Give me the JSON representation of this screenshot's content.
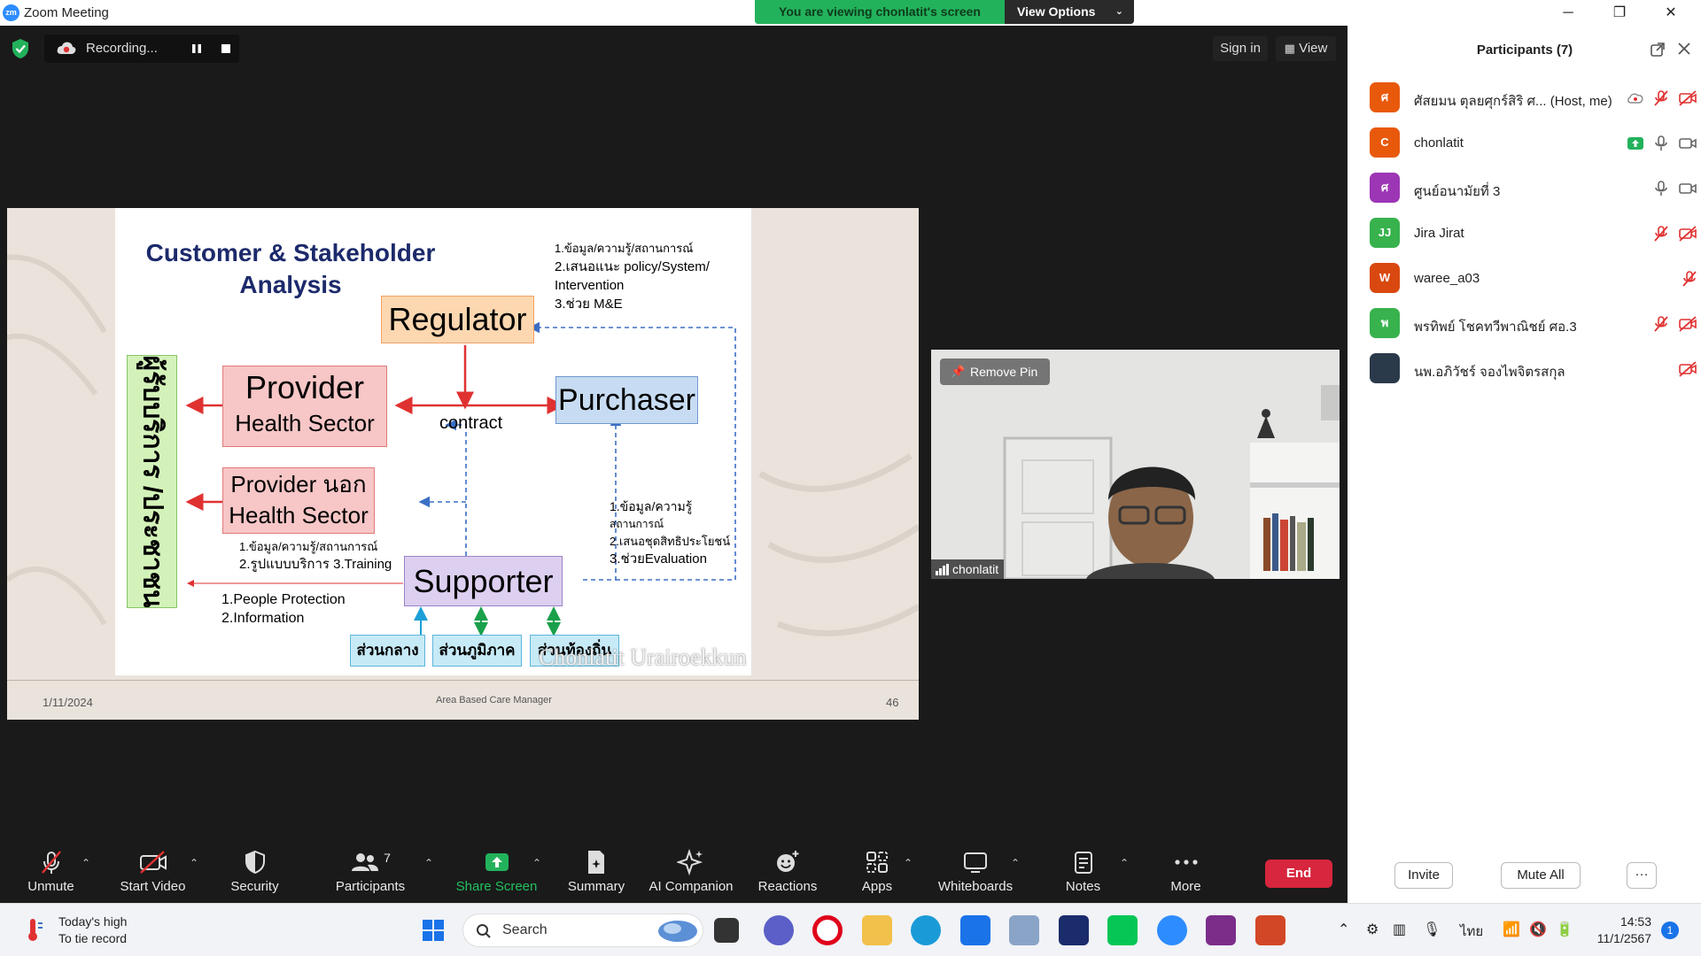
{
  "window": {
    "title": "Zoom Meeting",
    "min": "─",
    "max": "❐",
    "close": "✕"
  },
  "banner": {
    "viewing": "You are viewing chonlatit's screen",
    "view_options": "View Options"
  },
  "recording": {
    "label": "Recording..."
  },
  "header": {
    "sign_in": "Sign in",
    "view": "View"
  },
  "slide": {
    "title_line1": "Customer & Stakeholder",
    "title_line2": "Analysis",
    "regulator": "Regulator",
    "provider": "Provider",
    "provider_sub": "Health Sector",
    "purchaser": "Purchaser",
    "contract": "contract",
    "provider2": "Provider นอก",
    "provider2_sub": "Health Sector",
    "supporter": "Supporter",
    "vertical_label": "ผู้รับบริการ /ประชาชน",
    "reg_note1": "1.ข้อมูล/ความรู้/สถานการณ์",
    "reg_note2": "2.เสนอแนะ policy/System/",
    "reg_note3": "Intervention",
    "reg_note4": "3.ช่วย M&E",
    "pur_note1": "1.ข้อมูล/ความรู้",
    "pur_note2": "สถานการณ์",
    "pur_note3": "2.เสนอชุดสิทธิประโยชน์",
    "pur_note4": "3.ช่วยEvaluation",
    "prov_note1": "1.ข้อมูล/ความรู้/สถานการณ์",
    "prov_note2": "2.รูปแบบบริการ 3.Training",
    "people1": "1.People Protection",
    "people2": "2.Information",
    "central": "ส่วนกลาง",
    "regional": "ส่วนภูมิภาค",
    "local": "ส่วนท้องถิ่น",
    "watermark": "Chonlatit Urairoekkun",
    "footer_date": "1/11/2024",
    "footer_center": "Area Based Care Manager",
    "footer_page": "46"
  },
  "video": {
    "remove_pin": "Remove Pin",
    "name": "chonlatit"
  },
  "toolbar": {
    "unmute": "Unmute",
    "start_video": "Start Video",
    "security": "Security",
    "participants": "Participants",
    "participants_count": "7",
    "share_screen": "Share Screen",
    "summary": "Summary",
    "ai_companion": "AI Companion",
    "reactions": "Reactions",
    "apps": "Apps",
    "whiteboards": "Whiteboards",
    "notes": "Notes",
    "more": "More",
    "end": "End"
  },
  "panel": {
    "title": "Participants (7)",
    "invite": "Invite",
    "mute_all": "Mute All",
    "more": "···",
    "participants": [
      {
        "initial": "ศ",
        "name": "ศัสยมน ตุลยศุกร์สิริ ศ...  (Host, me)",
        "color": "#e8590c"
      },
      {
        "initial": "C",
        "name": "chonlatit",
        "color": "#e8590c"
      },
      {
        "initial": "ศ",
        "name": "ศูนย์อนามัยที่ 3",
        "color": "#9c36b5"
      },
      {
        "initial": "JJ",
        "name": "Jira Jirat",
        "color": "#37b24d"
      },
      {
        "initial": "W",
        "name": "waree_a03",
        "color": "#d9480f"
      },
      {
        "initial": "พ",
        "name": "พรทิพย์ โชคทวีพาณิชย์ ศอ.3",
        "color": "#37b24d"
      },
      {
        "initial": "",
        "name": "นพ.อภิวัชร์ จองไพจิตรสกุล",
        "color": "#2b3a4a"
      }
    ]
  },
  "taskbar": {
    "weather1": "Today's high",
    "weather2": "To tie record",
    "search": "Search",
    "lang": "ไทย",
    "time": "14:53",
    "date": "11/1/2567",
    "badge": "1"
  }
}
